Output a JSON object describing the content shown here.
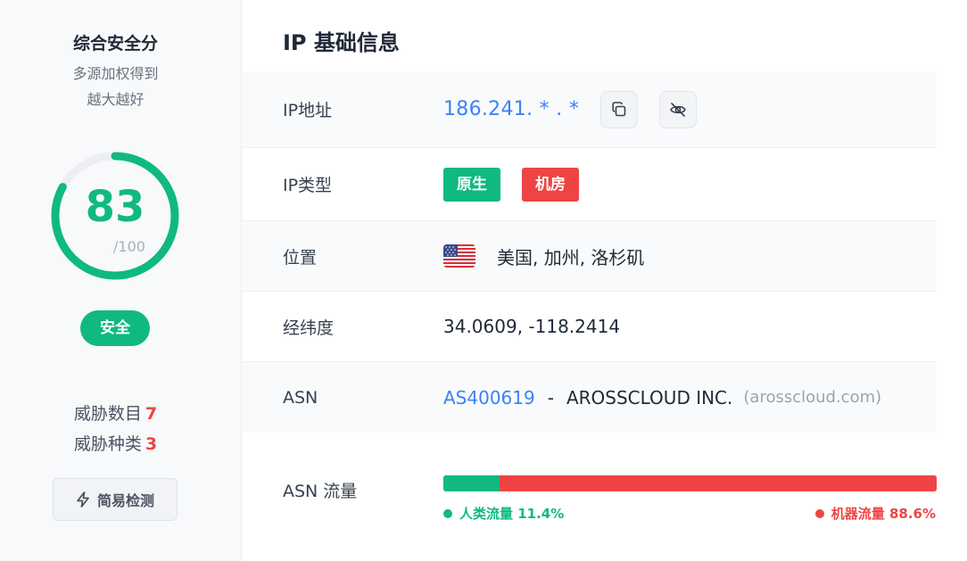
{
  "score_panel": {
    "title": "综合安全分",
    "subtitle_line1": "多源加权得到",
    "subtitle_line2": "越大越好",
    "score": "83",
    "score_max": "/100",
    "score_fraction": 0.83,
    "status_label": "安全",
    "threat_count_label": "威胁数目",
    "threat_count": "7",
    "threat_type_label": "威胁种类",
    "threat_types": "3",
    "quick_check_label": "简易检测",
    "colors": {
      "safe": "#10b981",
      "danger": "#ef4444",
      "track": "#eceef2"
    }
  },
  "ip_info": {
    "section_title": "IP 基础信息",
    "ip_label": "IP地址",
    "ip_value": "186.241. * . *",
    "copy_icon": "copy-icon",
    "hide_icon": "eye-off-icon",
    "type_label": "IP类型",
    "type_tags": [
      "原生",
      "机房"
    ],
    "location_label": "位置",
    "location_flag": "us-flag-icon",
    "location_value": "美国, 加州, 洛杉矶",
    "coords_label": "经纬度",
    "coords_value": "34.0609, -118.2414",
    "asn_label": "ASN",
    "asn_number": "AS400619",
    "asn_separator": "-",
    "asn_org": "AROSSCLOUD INC.",
    "asn_domain": "(arosscloud.com)"
  },
  "asn_traffic": {
    "label": "ASN 流量",
    "human_label": "人类流量 11.4%",
    "bot_label": "机器流量 88.6%",
    "human_percent": 11.4,
    "bot_percent": 88.6
  }
}
